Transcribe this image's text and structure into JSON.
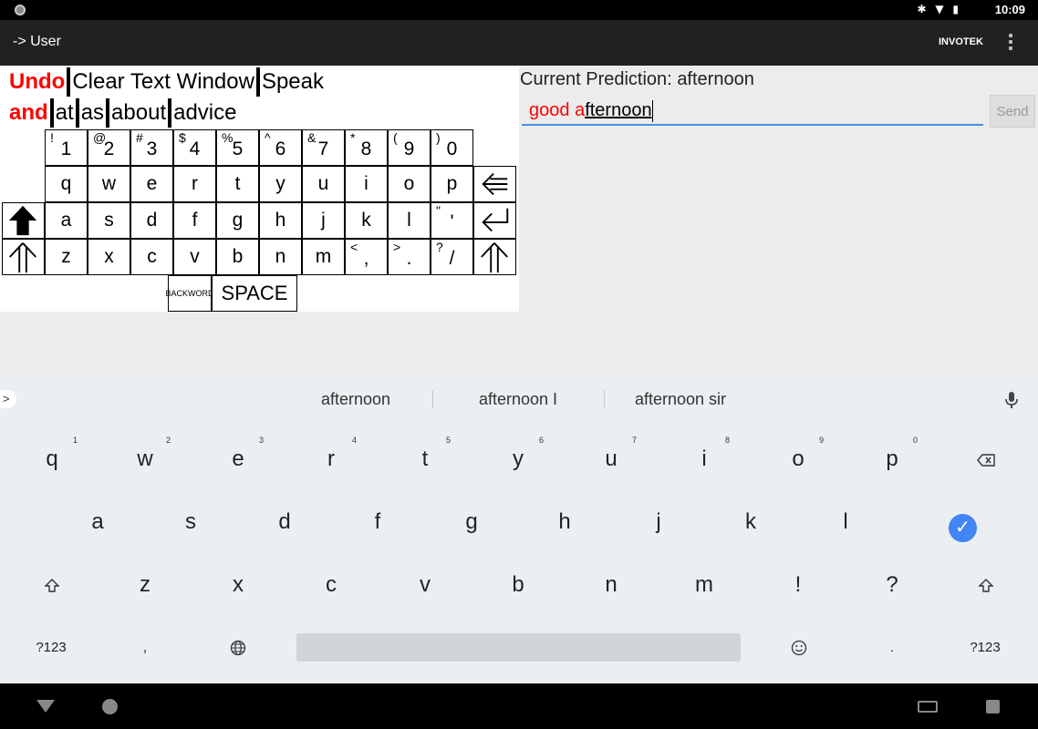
{
  "status": {
    "icons": "✱ ▼ ▮",
    "time": "10:09"
  },
  "appbar": {
    "title": "-> User",
    "brand": "INVOTEK"
  },
  "commands": {
    "undo": "Undo",
    "clear": "Clear Text Window",
    "speak": "Speak",
    "words": [
      "and",
      "at",
      "as",
      "about",
      "advice"
    ]
  },
  "onscreen_keyboard": {
    "numbers": [
      {
        "main": "1",
        "shift": "!"
      },
      {
        "main": "2",
        "shift": "@"
      },
      {
        "main": "3",
        "shift": "#"
      },
      {
        "main": "4",
        "shift": "$"
      },
      {
        "main": "5",
        "shift": "%"
      },
      {
        "main": "6",
        "shift": "^"
      },
      {
        "main": "7",
        "shift": "&"
      },
      {
        "main": "8",
        "shift": "*"
      },
      {
        "main": "9",
        "shift": "("
      },
      {
        "main": "0",
        "shift": ")"
      }
    ],
    "row1": [
      "q",
      "w",
      "e",
      "r",
      "t",
      "y",
      "u",
      "i",
      "o",
      "p"
    ],
    "row2": [
      "a",
      "s",
      "d",
      "f",
      "g",
      "h",
      "j",
      "k",
      "l"
    ],
    "row2_quote": {
      "main": "'",
      "shift": "\""
    },
    "row3": [
      "z",
      "x",
      "c",
      "v",
      "b",
      "n",
      "m"
    ],
    "row3_punct": [
      {
        "main": ",",
        "shift": "<"
      },
      {
        "main": ".",
        "shift": ">"
      },
      {
        "main": "/",
        "shift": "?"
      }
    ],
    "backword": "BACKWORD",
    "space": "SPACE"
  },
  "prediction": {
    "label": "Current Prediction:",
    "value": "afternoon"
  },
  "input": {
    "text_prefix": "good ",
    "text_typed": "a",
    "text_rest": "fternoon"
  },
  "send_label": "Send",
  "suggestions": [
    "afternoon",
    "afternoon I",
    "afternoon sir"
  ],
  "ime": {
    "row1": [
      {
        "key": "q",
        "hint": "1"
      },
      {
        "key": "w",
        "hint": "2"
      },
      {
        "key": "e",
        "hint": "3"
      },
      {
        "key": "r",
        "hint": "4"
      },
      {
        "key": "t",
        "hint": "5"
      },
      {
        "key": "y",
        "hint": "6"
      },
      {
        "key": "u",
        "hint": "7"
      },
      {
        "key": "i",
        "hint": "8"
      },
      {
        "key": "o",
        "hint": "9"
      },
      {
        "key": "p",
        "hint": "0"
      }
    ],
    "row2": [
      "a",
      "s",
      "d",
      "f",
      "g",
      "h",
      "j",
      "k",
      "l"
    ],
    "row3": [
      "z",
      "x",
      "c",
      "v",
      "b",
      "n",
      "m",
      "!",
      "?"
    ],
    "row4": {
      "left": "?123",
      "comma": ",",
      "period": ".",
      "right": "?123"
    }
  }
}
